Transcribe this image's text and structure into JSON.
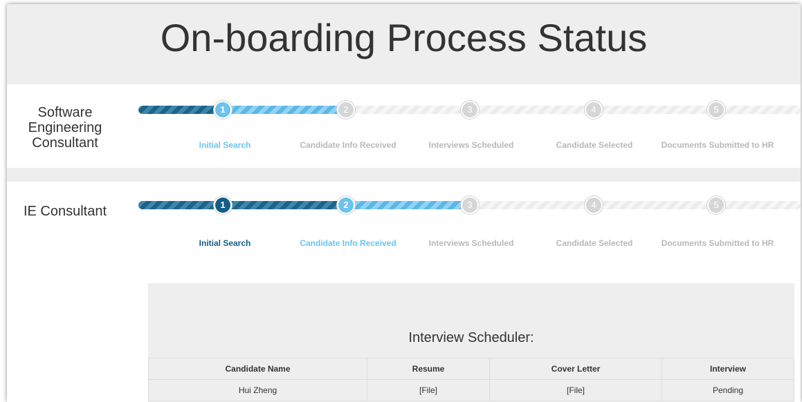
{
  "page": {
    "title": "On-boarding Process Status"
  },
  "colors": {
    "done": "#135d86",
    "active": "#6cc3ee",
    "todo": "#b8b8b8",
    "header_bg": "#eeeeee"
  },
  "positions": [
    {
      "title_lines": [
        "Software",
        "Engineering",
        "Consultant"
      ],
      "steps": [
        {
          "number": "1",
          "label": "Initial Search",
          "state": "active"
        },
        {
          "number": "2",
          "label": "Candidate Info Received",
          "state": "todo"
        },
        {
          "number": "3",
          "label": "Interviews Scheduled",
          "state": "todo"
        },
        {
          "number": "4",
          "label": "Candidate Selected",
          "state": "todo"
        },
        {
          "number": "5",
          "label": "Documents Submitted to HR",
          "state": "todo"
        }
      ]
    },
    {
      "title_lines": [
        "IE Consultant"
      ],
      "steps": [
        {
          "number": "1",
          "label": "Initial Search",
          "state": "done"
        },
        {
          "number": "2",
          "label": "Candidate Info Received",
          "state": "active"
        },
        {
          "number": "3",
          "label": "Interviews Scheduled",
          "state": "todo"
        },
        {
          "number": "4",
          "label": "Candidate Selected",
          "state": "todo"
        },
        {
          "number": "5",
          "label": "Documents Submitted to HR",
          "state": "todo"
        }
      ]
    }
  ],
  "scheduler": {
    "title": "Interview Scheduler:",
    "columns": [
      "Candidate Name",
      "Resume",
      "Cover Letter",
      "Interview"
    ],
    "rows": [
      {
        "name": "Hui Zheng",
        "resume": "[File]",
        "cover_letter": "[File]",
        "interview": "Pending"
      }
    ]
  }
}
